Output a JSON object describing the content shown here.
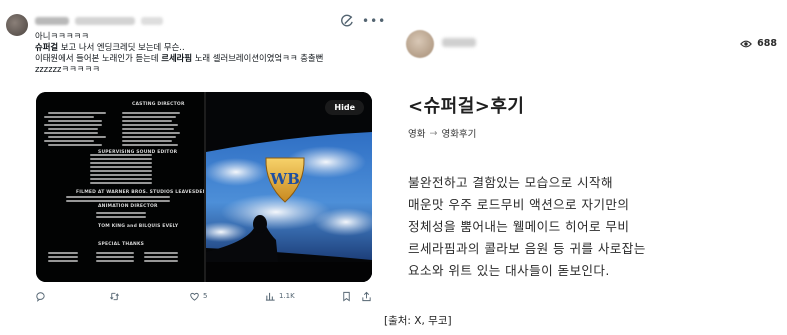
{
  "tweet": {
    "lines": [
      {
        "parts": [
          {
            "t": "아니ㅋㅋㅋㅋㅋ",
            "b": false
          }
        ]
      },
      {
        "parts": [
          {
            "t": "슈퍼걸",
            "b": true
          },
          {
            "t": " 보고 나서 엔딩크레딧 보는데 무슨..",
            "b": false
          }
        ]
      },
      {
        "parts": [
          {
            "t": "이태원에서 들어본 노래인가 듣는데 ",
            "b": false
          },
          {
            "t": "르세라핌",
            "b": true
          },
          {
            "t": " 노래 셀러브레이션이였엌ㅋㅋ 충출뻔",
            "b": false
          }
        ]
      },
      {
        "parts": [
          {
            "t": "zzzzzzㅋㅋㅋㅋㅋ",
            "b": false
          }
        ]
      }
    ],
    "media": {
      "hide_label": "Hide",
      "credit_headers": [
        "CASTING DIRECTOR",
        "SUPERVISING SOUND EDITOR",
        "FILMED AT WARNER BROS. STUDIOS LEAVESDEN, ENGLAND",
        "ANIMATION DIRECTOR",
        "TOM KING and BILQUIS EVELY",
        "SPECIAL THANKS"
      ]
    },
    "actions": {
      "replies": "",
      "reposts": "",
      "likes": "5",
      "views": "1.1K"
    }
  },
  "post": {
    "views": "688",
    "title": "<슈퍼걸>후기",
    "breadcrumb": {
      "category": "영화",
      "arrow": "→",
      "subcategory": "영화후기"
    },
    "body_lines": [
      "불완전하고 결함있는 모습으로 시작해",
      "매운맛 우주 로드무비 액션으로 자기만의",
      "정체성을 뿜어내는 웰메이드 히어로 무비",
      "르세라핌과의 콜라보 음원 등 귀를 사로잡는",
      "요소와 위트 있는 대사들이 돋보인다."
    ]
  },
  "caption": "[출처: X, 무코]",
  "colors": {
    "text": "#0f1419",
    "muted": "#536471",
    "accent_blue": "#1d9bf0"
  }
}
